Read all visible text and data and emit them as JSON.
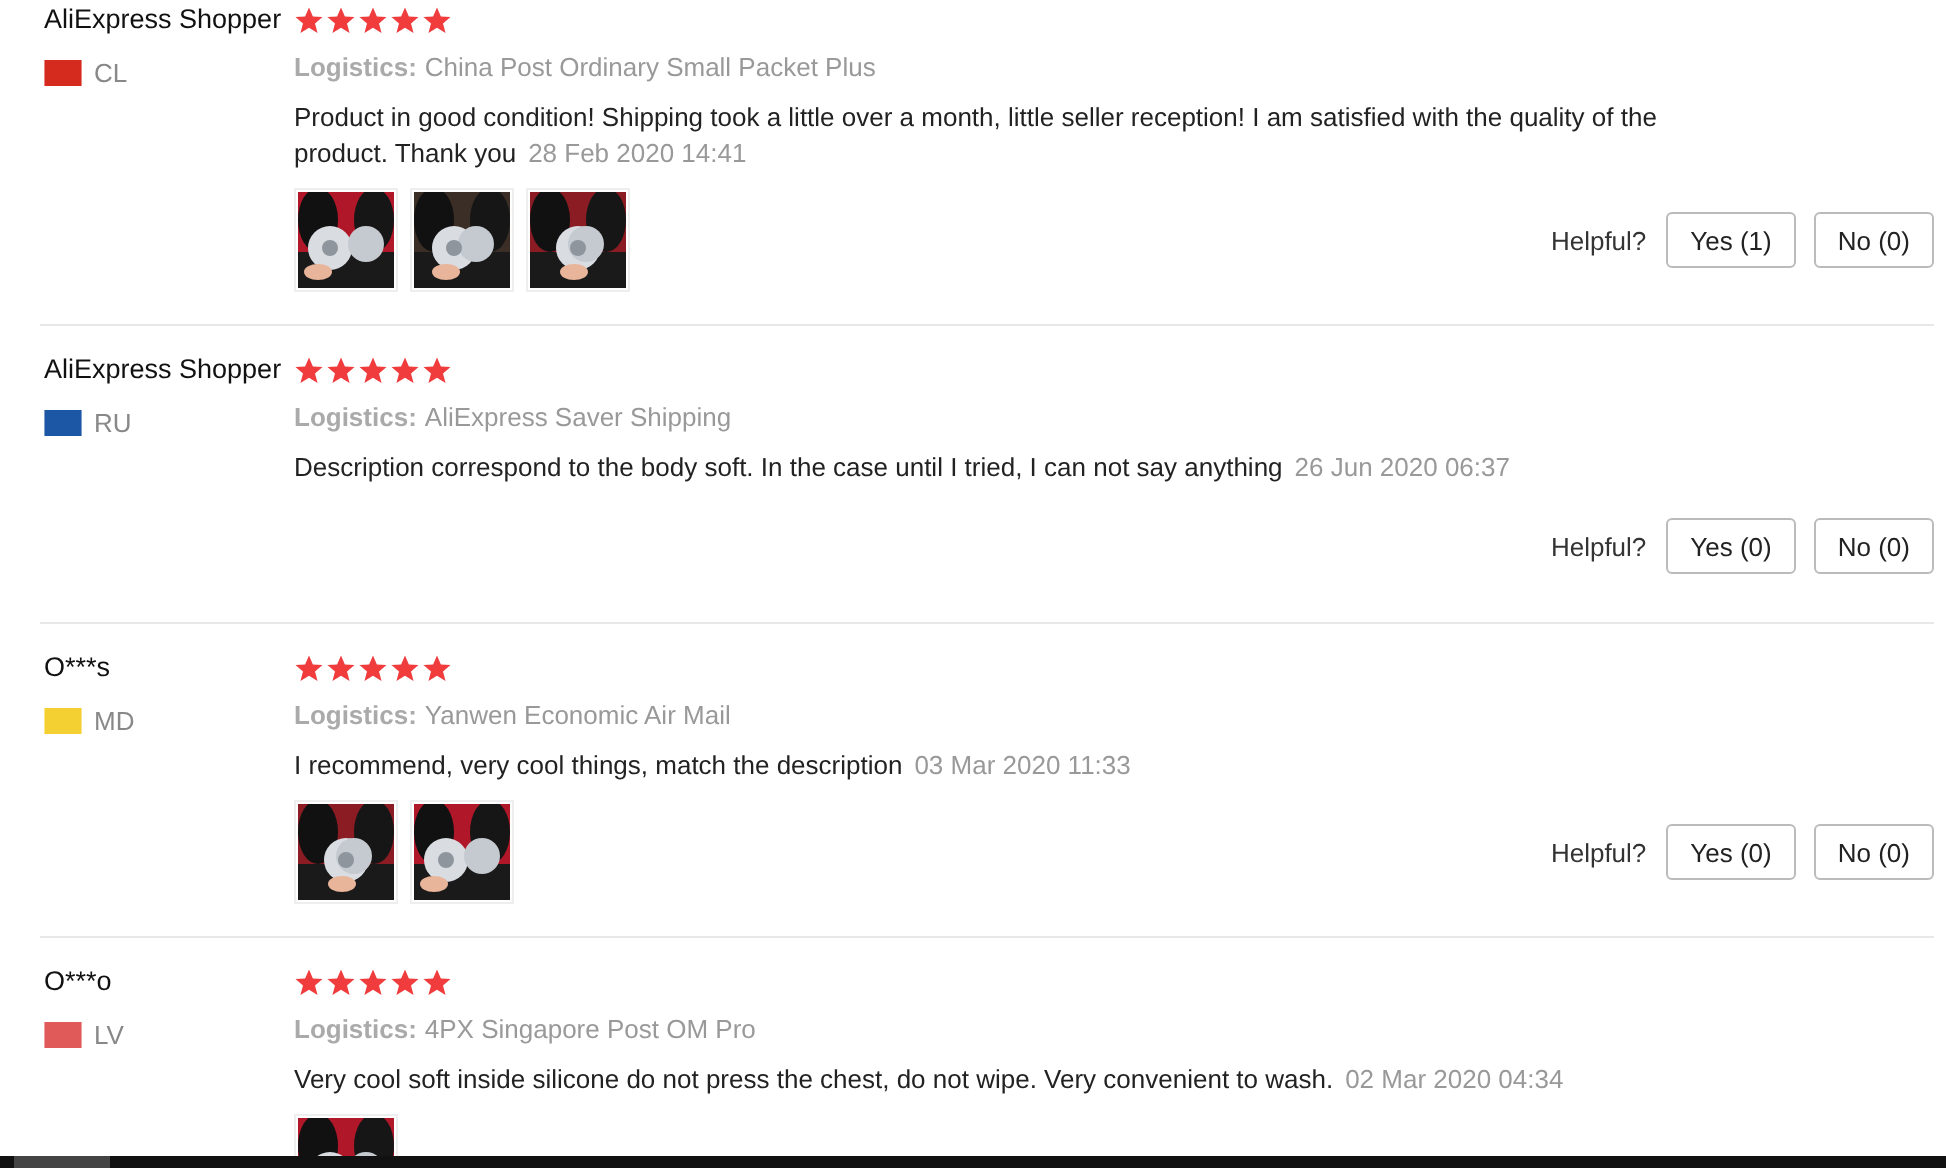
{
  "reviews": [
    {
      "name": "AliExpress Shopper",
      "stars": 5,
      "country": "CL",
      "color": "#d52b1e",
      "logistics_label": "Logistics:",
      "logistics": "China Post Ordinary Small Packet Plus",
      "text": "Product in good condition! Shipping took a little over a month, little seller reception! I am satisfied with the quality of the product. Thank you",
      "date": "28 Feb 2020 14:41",
      "photos": [
        {
          "kind": "picture"
        },
        {
          "kind": "picture"
        },
        {
          "kind": "picture"
        }
      ],
      "helpful": {
        "label": "Helpful?",
        "yes": "Yes (1)",
        "no": "No (0)"
      }
    },
    {
      "name": "AliExpress Shopper",
      "stars": 5,
      "country": "RU",
      "color": "#1c57a5",
      "logistics_label": "Logistics:",
      "logistics": "AliExpress Saver Shipping",
      "text": "Description correspond to the body soft. In the case until I tried, I can not say anything",
      "date": "26 Jun 2020 06:37",
      "helpful": {
        "label": "Helpful?",
        "yes": "Yes (0)",
        "no": "No (0)"
      }
    },
    {
      "name": "O***s",
      "stars": 5,
      "country": "MD",
      "color": "#f5d033",
      "logistics_label": "Logistics:",
      "logistics": "Yanwen Economic Air Mail",
      "text": "I recommend, very cool things, match the description",
      "date": "03 Mar 2020 11:33",
      "photos": [
        {
          "kind": "picture"
        },
        {
          "kind": "picture"
        }
      ],
      "helpful": {
        "label": "Helpful?",
        "yes": "Yes (0)",
        "no": "No (0)"
      }
    },
    {
      "name": "O***o",
      "stars": 5,
      "country": "LV",
      "color": "#e05a5a",
      "logistics_label": "Logistics:",
      "logistics": "4PX Singapore Post OM Pro",
      "text": "Very cool soft inside silicone do not press the chest, do not wipe. Very convenient to wash.",
      "date": "02 Mar 2020 04:34",
      "photos": [
        {
          "kind": "picture"
        }
      ]
    }
  ]
}
